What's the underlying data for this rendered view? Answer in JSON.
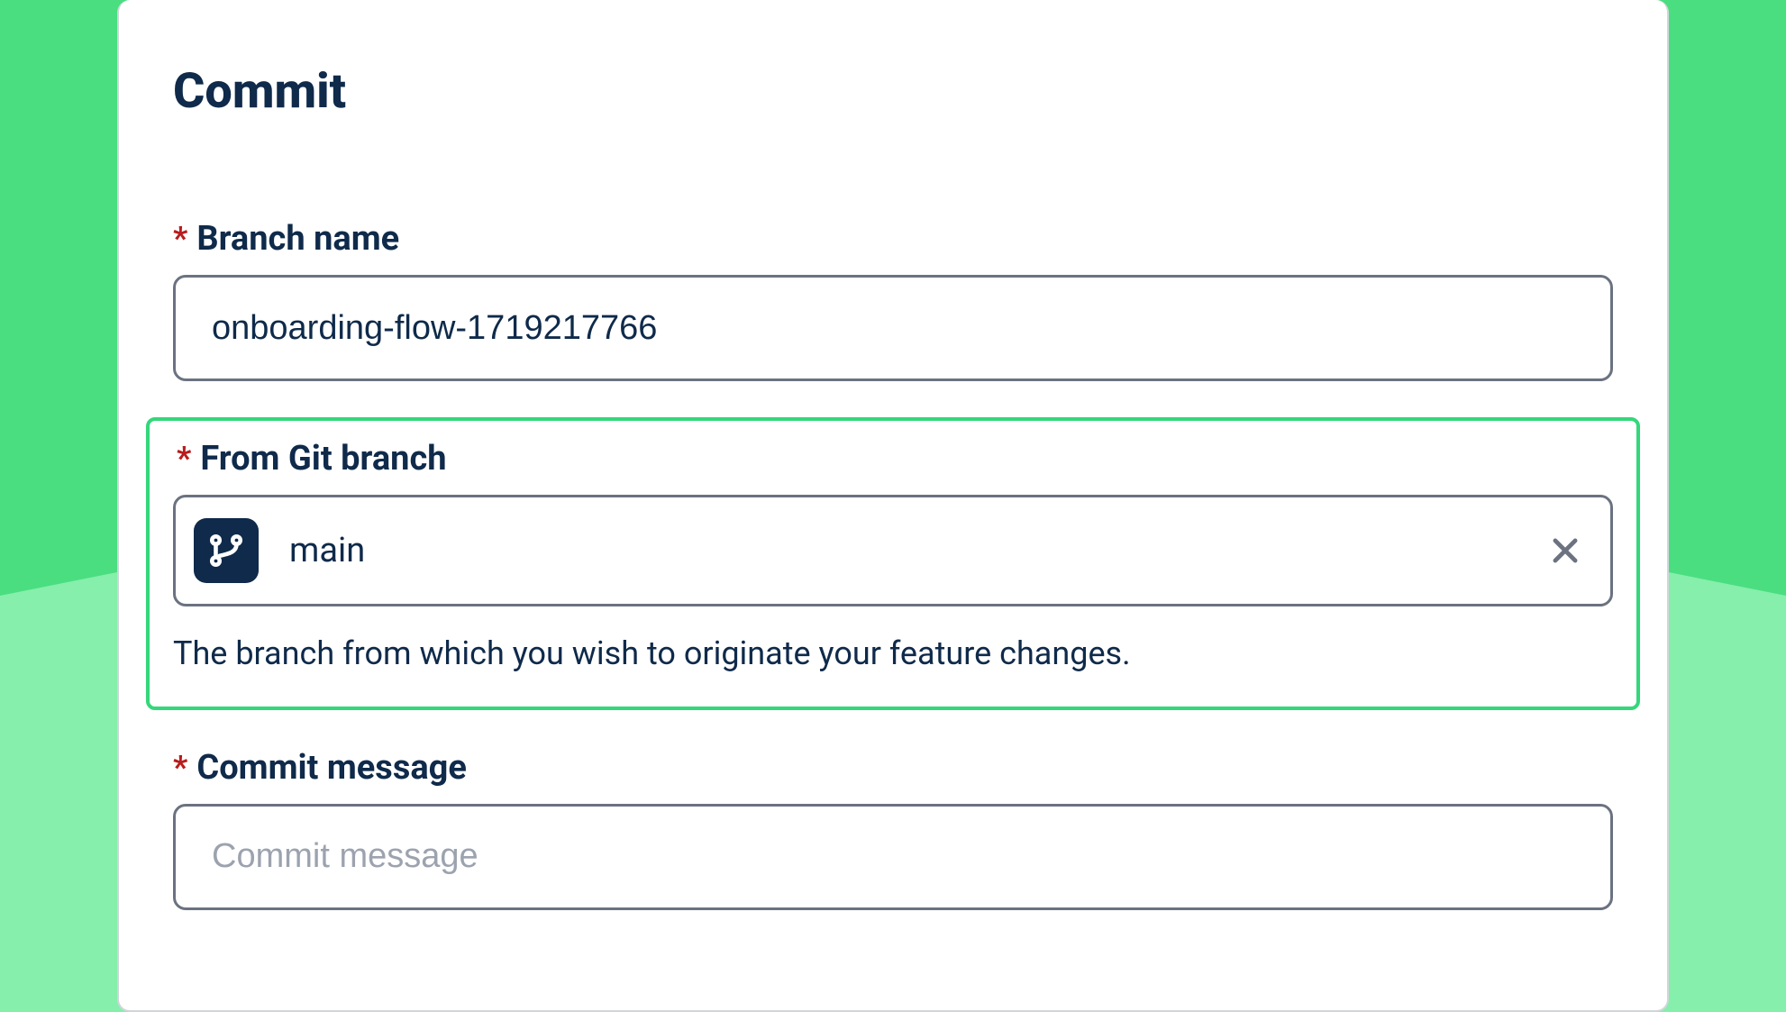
{
  "panel": {
    "title": "Commit"
  },
  "fields": {
    "branchName": {
      "label": "Branch name",
      "required": "*",
      "value": "onboarding-flow-1719217766"
    },
    "fromGitBranch": {
      "label": "From Git branch",
      "required": "*",
      "value": "main",
      "help": "The branch from which you wish to originate your feature changes."
    },
    "commitMessage": {
      "label": "Commit message",
      "required": "*",
      "placeholder": "Commit message",
      "value": ""
    }
  }
}
